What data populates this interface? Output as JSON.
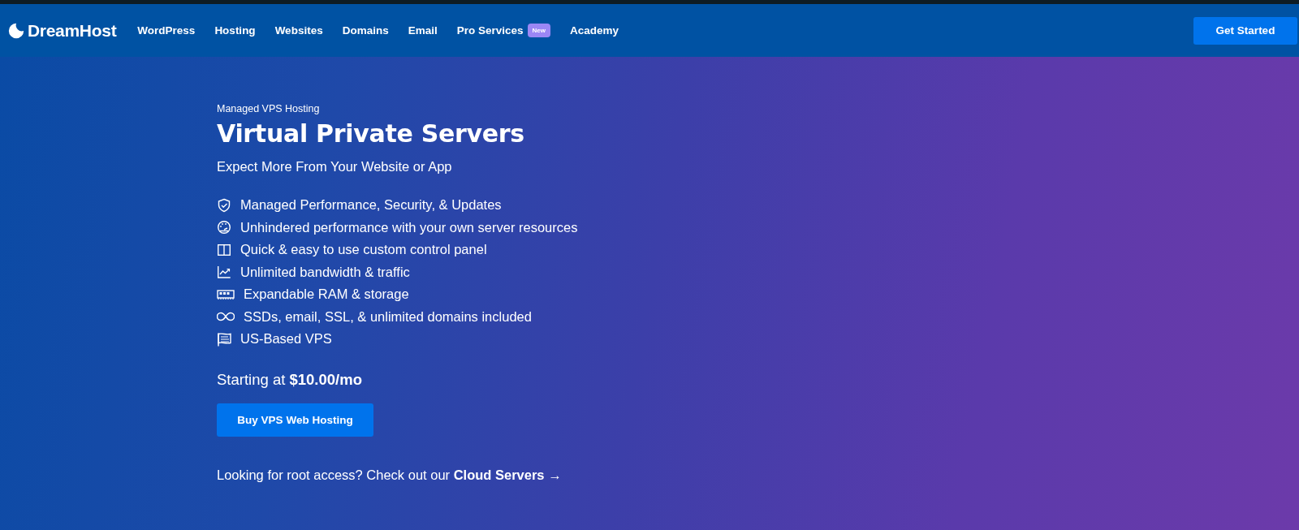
{
  "nav": {
    "logo": "DreamHost",
    "links": [
      {
        "label": "WordPress"
      },
      {
        "label": "Hosting"
      },
      {
        "label": "Websites"
      },
      {
        "label": "Domains"
      },
      {
        "label": "Email"
      },
      {
        "label": "Pro Services",
        "badge": "New"
      },
      {
        "label": "Academy"
      }
    ],
    "cta": "Get Started"
  },
  "hero": {
    "eyebrow": "Managed VPS Hosting",
    "title": "Virtual Private Servers",
    "subtitle": "Expect More From Your Website or App",
    "features": [
      {
        "kind": "shield",
        "text": "Managed Performance, Security, & Updates"
      },
      {
        "kind": "gauge",
        "text": "Unhindered performance with your own server resources"
      },
      {
        "kind": "panel",
        "text": "Quick & easy to use custom control panel"
      },
      {
        "kind": "chart",
        "text": "Unlimited bandwidth & traffic"
      },
      {
        "kind": "ram",
        "text": "Expandable RAM & storage"
      },
      {
        "kind": "infinity",
        "text": "SSDs, email, SSL, & unlimited domains included"
      },
      {
        "kind": "flag",
        "text": "US-Based VPS"
      }
    ],
    "price": "Starting at **$10.00/mo**",
    "button": "Buy VPS Web Hosting",
    "root_access": {
      "text": "Looking for root access? Check out our",
      "link": "Cloud Servers →"
    }
  }
}
